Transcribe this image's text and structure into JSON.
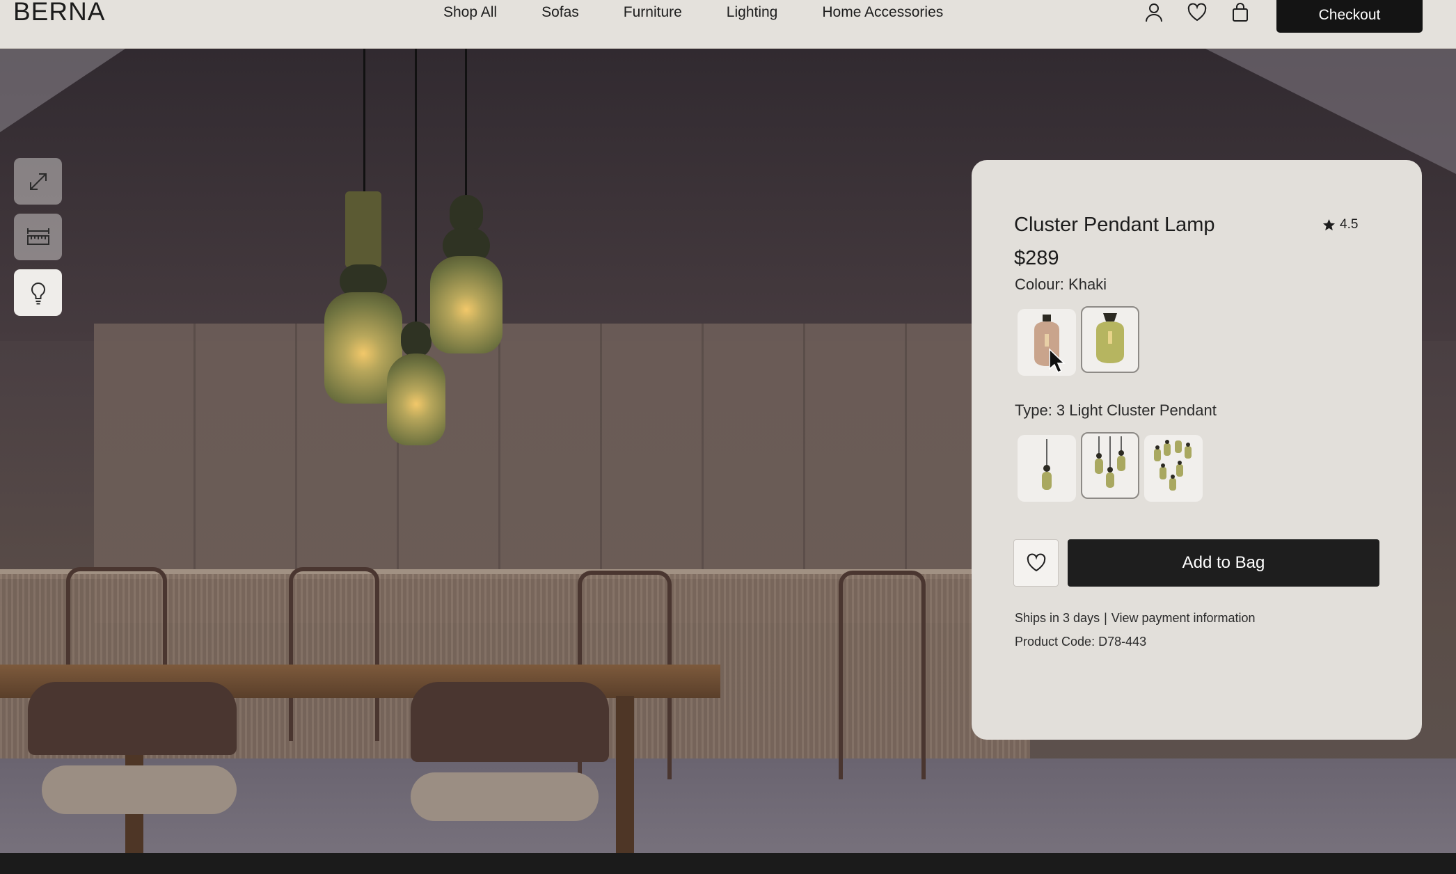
{
  "brand": "BERNA",
  "nav": {
    "items": [
      "Shop All",
      "Sofas",
      "Furniture",
      "Lighting",
      "Home Accessories"
    ]
  },
  "header_icons": [
    "user-icon",
    "heart-icon",
    "shopping-bag-icon"
  ],
  "checkout_label": "Checkout",
  "tools": [
    "expand-icon",
    "ruler-icon",
    "lightbulb-icon"
  ],
  "product": {
    "title": "Cluster Pendant Lamp",
    "rating": "4.5",
    "price": "$289",
    "colour_label": "Colour: Khaki",
    "colours": [
      {
        "swatch": "#c9a48c",
        "selected": false
      },
      {
        "swatch": "#b6b560",
        "selected": true
      }
    ],
    "type_label": "Type: 3 Light Cluster Pendant",
    "types": [
      {
        "lights": 1,
        "selected": false
      },
      {
        "lights": 3,
        "selected": true
      },
      {
        "lights": 6,
        "selected": false
      }
    ],
    "add_to_bag": "Add to Bag",
    "ships": "Ships in 3 days",
    "separator": "|",
    "payment_link": "View payment information",
    "product_code": "Product Code: D78-443"
  },
  "colors": {
    "topbar": "#e4e1dc",
    "panel": "#e2dfda",
    "button": "#1e1e1e"
  }
}
